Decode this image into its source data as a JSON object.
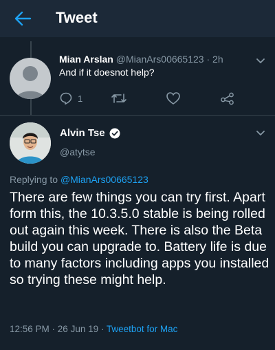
{
  "header": {
    "title": "Tweet"
  },
  "parent_tweet": {
    "author_name": "Mian Arslan",
    "author_handle": "@MianArs00665123",
    "time_sep": " · ",
    "time": "2h",
    "text": "And if it doesnot help?",
    "reply_count": "1"
  },
  "main_tweet": {
    "author_name": "Alvin Tse",
    "author_handle": "@atytse",
    "replying_prefix": "Replying to ",
    "replying_to": "@MianArs00665123",
    "text": "There are few things you can try first. Apart form this, the 10.3.5.0 stable is being rolled out again this week. There is also the Beta build you can upgrade to. Battery life is due to many factors including apps you installed so trying these might help.",
    "time": "12:56 PM",
    "date_sep": " · ",
    "date": "26 Jun 19",
    "client_sep": " · ",
    "client": "Tweetbot for Mac"
  },
  "colors": {
    "background": "#15202b",
    "header": "#1c2938",
    "accent": "#1da1f2",
    "muted": "#8899a6"
  }
}
